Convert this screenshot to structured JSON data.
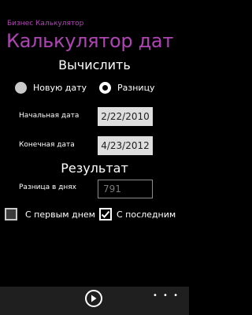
{
  "header": {
    "app_title": "Бизнес Калькулятор",
    "page_title": "Калькулятор дат"
  },
  "calculate": {
    "heading": "Вычислить",
    "options": [
      {
        "label": "Новую дату",
        "selected": false
      },
      {
        "label": "Разницу",
        "selected": true
      }
    ]
  },
  "fields": {
    "start_label": "Начальная дата",
    "start_value": "2/22/2010",
    "end_label": "Конечная дата",
    "end_value": "4/23/2012"
  },
  "result": {
    "heading": "Результат",
    "diff_label": "Разница в днях",
    "diff_value": "791"
  },
  "checkboxes": [
    {
      "label": "С первым днем",
      "checked": false
    },
    {
      "label": "С последним",
      "checked": true
    }
  ],
  "appbar": {
    "play_icon": "play-icon",
    "more_label": "• • •"
  },
  "colors": {
    "accent": "#b044b5",
    "background": "#000000"
  }
}
